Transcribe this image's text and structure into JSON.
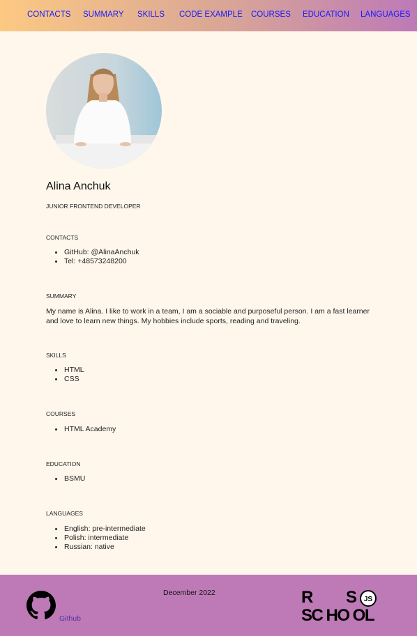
{
  "nav": {
    "items": [
      {
        "label": "CONTACTS"
      },
      {
        "label": "SUMMARY"
      },
      {
        "label": "SKILLS"
      },
      {
        "label": "CODE EXAMPLE"
      },
      {
        "label": "COURSES"
      },
      {
        "label": "EDUCATION"
      },
      {
        "label": "LANGUAGES"
      }
    ]
  },
  "profile": {
    "name": "Alina Anchuk",
    "role": "JUNIOR FRONTEND DEVELOPER"
  },
  "contacts": {
    "title": "CONTACTS",
    "items": [
      "GitHub: @AlinaAnchuk",
      "Tel: +48573248200"
    ]
  },
  "summary": {
    "title": "SUMMARY",
    "text": "My name is Alina. I like to work in a team, I am a sociable and purposeful person. I am a fast learner and love to learn new things. My hobbies include sports, reading and traveling."
  },
  "skills": {
    "title": "SKILLS",
    "items": [
      "HTML",
      "CSS"
    ]
  },
  "courses": {
    "title": "COURSES",
    "items": [
      "HTML Academy"
    ]
  },
  "education": {
    "title": "EDUCATION",
    "items": [
      "BSMU"
    ]
  },
  "languages": {
    "title": "LANGUAGES",
    "items": [
      "English: pre-intermediate",
      "Polish: intermediate",
      "Russian: native"
    ]
  },
  "footer": {
    "github_label": "Github",
    "date": "December 2022",
    "logo": {
      "line1_left": "R",
      "line1_right": "S",
      "line2": "SC HO OL",
      "badge": "JS"
    }
  },
  "icons": {
    "github": "github-icon",
    "logo": "rs-school-logo"
  },
  "colors": {
    "background": "#fff7ec",
    "nav_gradient_start": "#fcc983",
    "nav_gradient_end": "#bd7ab7",
    "footer": "#bd7ab7",
    "link": "#1a1aff"
  }
}
